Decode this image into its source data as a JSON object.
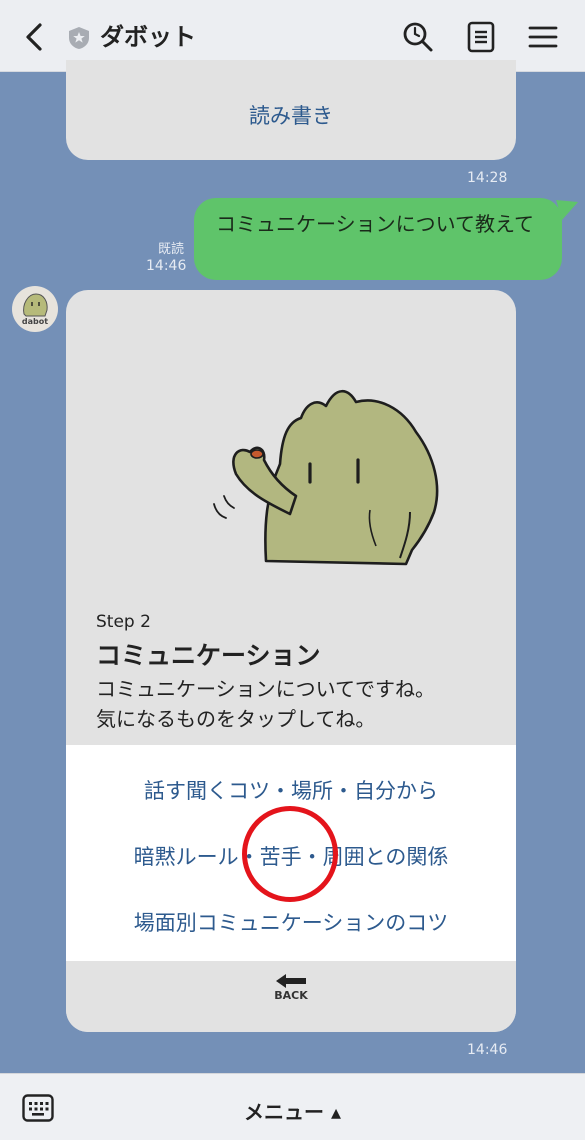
{
  "header": {
    "title": "ダボット"
  },
  "prev_card": {
    "link": "読み書き",
    "time": "14:28"
  },
  "user_message": {
    "text": "コミュニケーションについて教えて",
    "read": "既読",
    "time": "14:46"
  },
  "bot": {
    "avatar_label": "dabot"
  },
  "card": {
    "step": "Step 2",
    "title": "コミュニケーション",
    "desc_line1": "コミュニケーションについてですね。",
    "desc_line2": "気になるものをタップしてね。",
    "options": [
      "話す聞くコツ・場所・自分から",
      "暗黙ルール・苦手・周囲との関係",
      "場面別コミュニケーションのコツ"
    ],
    "back_label": "BACK",
    "time": "14:46"
  },
  "bottom": {
    "menu": "メニュー ▴"
  },
  "colors": {
    "accent": "#2d5a8e",
    "bubble": "#5fc46a",
    "highlight_circle": "#e4141b",
    "background": "#7490b7"
  },
  "icons": [
    "back-arrow-icon",
    "shield-icon",
    "search-icon",
    "note-icon",
    "menu-icon",
    "keyboard-icon",
    "back-arrow-icon"
  ]
}
